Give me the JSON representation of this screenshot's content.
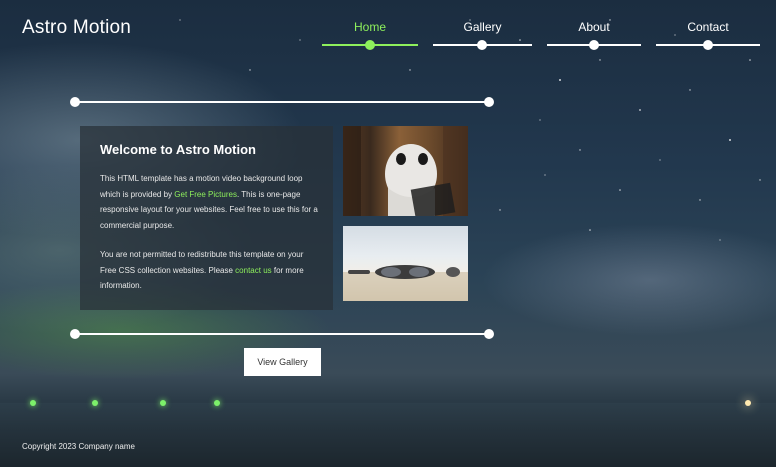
{
  "brand": {
    "logo": "Astro Motion"
  },
  "nav": {
    "items": [
      {
        "label": "Home",
        "active": true
      },
      {
        "label": "Gallery",
        "active": false
      },
      {
        "label": "About",
        "active": false
      },
      {
        "label": "Contact",
        "active": false
      }
    ],
    "active_color": "#8ef05c"
  },
  "main": {
    "title": "Welcome to Astro Motion",
    "para1": {
      "before": "This HTML template has a motion video background loop which is provided by ",
      "link": "Get Free Pictures",
      "after": ". This is one-page responsive layout for your websites. Feel free to use this for a commercial purpose."
    },
    "para2": {
      "before": "You are not permitted to redistribute this template on your Free CSS collection websites. Please ",
      "link": "contact us",
      "after": " for more information."
    },
    "button": "View Gallery"
  },
  "footer": {
    "copyright": "Copyright 2023 Company name"
  }
}
